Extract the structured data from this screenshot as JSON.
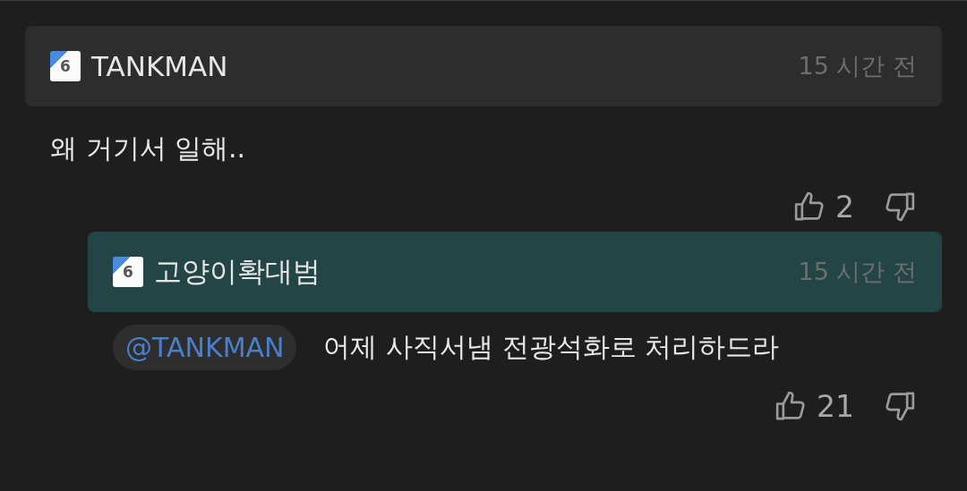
{
  "comments": [
    {
      "kind": "top",
      "badge": "6",
      "author": "TANKMAN",
      "time": "15 시간 전",
      "text": "왜 거기서 일해..",
      "likes": "2"
    },
    {
      "kind": "reply",
      "badge": "6",
      "author": "고양이확대범",
      "time": "15 시간 전",
      "mention": "@TANKMAN",
      "text": "어제 사직서냄 전광석화로 처리하드라",
      "likes": "21"
    }
  ]
}
